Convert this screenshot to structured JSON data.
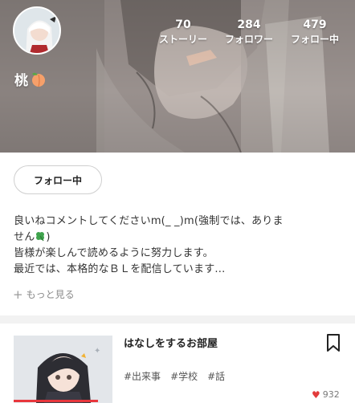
{
  "profile": {
    "username": "桃",
    "username_emoji": "peach-icon"
  },
  "stats": {
    "stories_value": "70",
    "stories_label": "ストーリー",
    "followers_value": "284",
    "followers_label": "フォロワー",
    "following_value": "479",
    "following_label": "フォロー中"
  },
  "follow_button": {
    "label": "フォロー中"
  },
  "bio": {
    "line1": "良いねコメントしてくださいm(_ _)m(強制では、ありま",
    "line2_text": "せん",
    "line2_suffix": ")",
    "line3": "皆様が楽しんで読めるように努力します。",
    "line4": "最近では、本格的なＢＬを配信しています..."
  },
  "more_link": {
    "label": "もっと見る"
  },
  "story": {
    "title": "はなしをするお部屋",
    "tags": [
      "#出来事",
      "#学校",
      "#話"
    ],
    "likes": "932",
    "read_progress": 0.85
  },
  "colors": {
    "accent_red": "#e8363c",
    "heart": "#e23b3b",
    "divider": "#f2f2f2"
  }
}
